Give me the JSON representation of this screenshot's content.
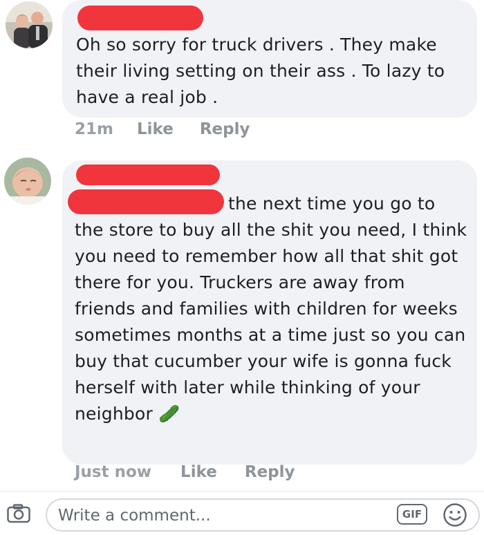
{
  "comments": [
    {
      "text": "Oh so sorry for truck drivers . They make their living setting on their ass . To lazy to have a real job .",
      "time": "21m",
      "like_label": "Like",
      "reply_label": "Reply"
    },
    {
      "text": "the next time you go to the store to buy all the shit you need, I think you need to remember how all that shit got there for you. Truckers are away from friends and families with children for weeks sometimes months at a time just so you can buy that cucumber your wife is gonna fuck herself with later while thinking of your neighbor",
      "emoji": "🥒",
      "time": "Just now",
      "like_label": "Like",
      "reply_label": "Reply"
    }
  ],
  "composer": {
    "placeholder": "Write a comment...",
    "gif_label": "GIF",
    "camera_icon": "camera-icon",
    "emoji_icon": "smiley-icon"
  },
  "colors": {
    "bubble": "#f1f2f6",
    "redaction": "#f0353c",
    "meta_text": "#8f949a"
  }
}
